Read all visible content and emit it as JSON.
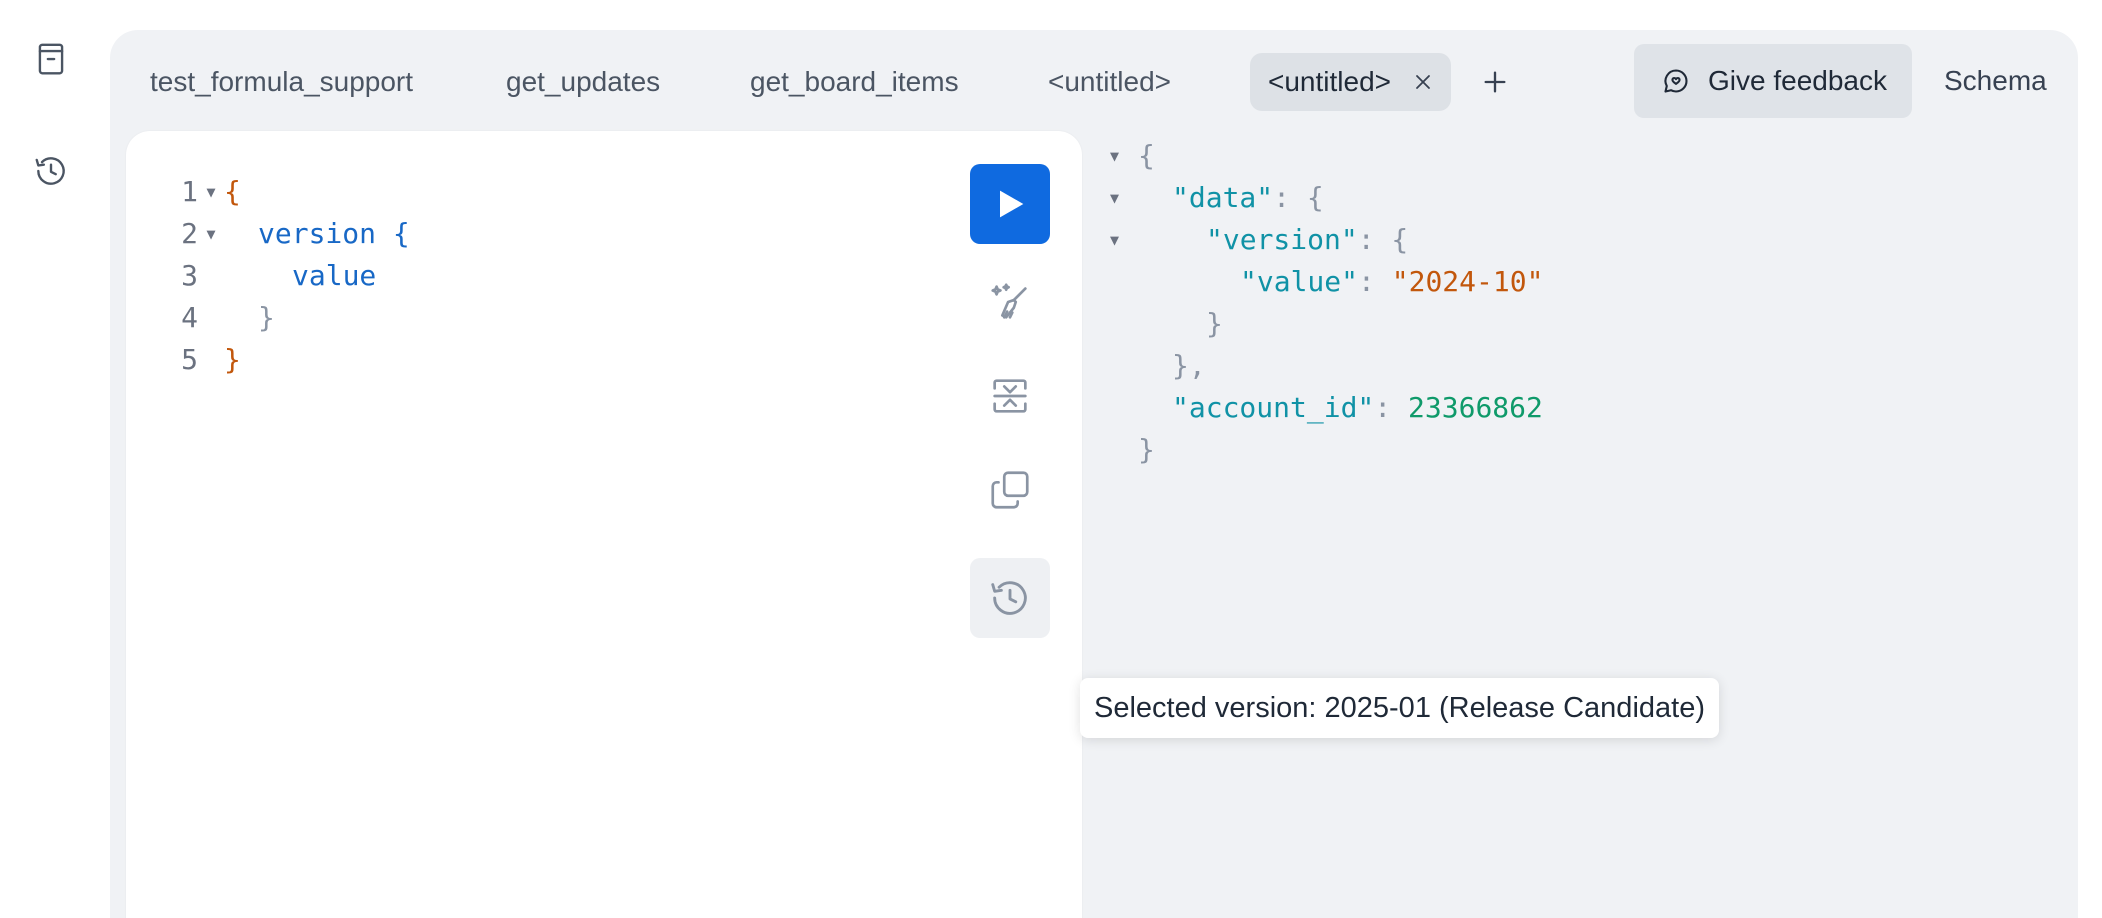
{
  "colors": {
    "accent": "#0f6ae0",
    "panel_bg": "#f0f2f5",
    "active_tab_bg": "#dde1e6",
    "json_key": "#1092a6",
    "json_string": "#c2570c",
    "json_number": "#0f9a6a",
    "query_field": "#1868c6"
  },
  "rail": {
    "items": [
      {
        "icon": "document-icon"
      },
      {
        "icon": "history-icon"
      }
    ]
  },
  "tabs": [
    {
      "label": "test_formula_support",
      "active": false
    },
    {
      "label": "get_updates",
      "active": false
    },
    {
      "label": "get_board_items",
      "active": false
    },
    {
      "label": "<untitled>",
      "active": false
    },
    {
      "label": "<untitled>",
      "active": true
    }
  ],
  "header": {
    "add_tab_icon": "plus-icon",
    "feedback_label": "Give feedback",
    "schema_label": "Schema"
  },
  "editor": {
    "lines": [
      {
        "num": "1",
        "text": "{"
      },
      {
        "num": "2",
        "text": "version {"
      },
      {
        "num": "3",
        "text": "value"
      },
      {
        "num": "4",
        "text": "}"
      },
      {
        "num": "5",
        "text": "}"
      }
    ],
    "toolbar": [
      "play-icon",
      "prettify-icon",
      "merge-icon",
      "copy-icon",
      "history-icon"
    ]
  },
  "tooltip": {
    "text": "Selected version: 2025-01 (Release Candidate)"
  },
  "result": {
    "data_key": "\"data\"",
    "version_key": "\"version\"",
    "value_key": "\"value\"",
    "value_val": "\"2024-10\"",
    "account_key": "\"account_id\"",
    "account_val": "23366862"
  }
}
